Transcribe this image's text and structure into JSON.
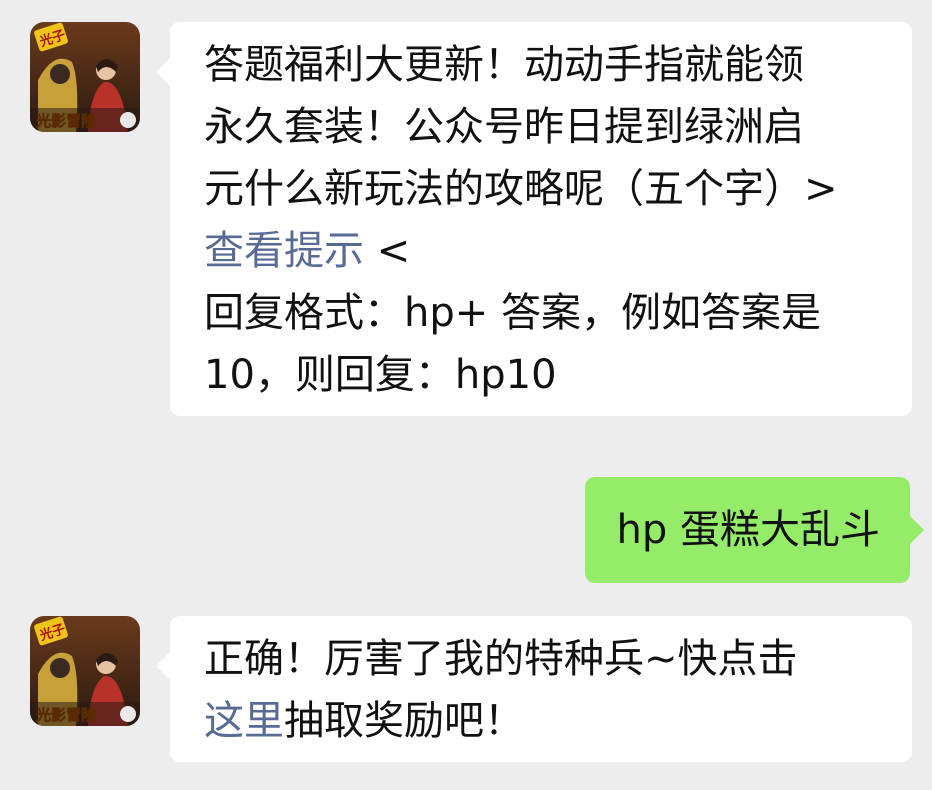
{
  "colors": {
    "background": "#ededed",
    "incoming_bubble": "#ffffff",
    "outgoing_bubble": "#95ec69",
    "link": "#576b95"
  },
  "avatar": {
    "icon": "game-app-icon",
    "badge_text": "光子",
    "banner_text": "光影冒险"
  },
  "messages": {
    "question": {
      "line1": "答题福利大更新！动动手指就能领",
      "line2": "永久套装！公众号昨日提到绿洲启",
      "line3": "元什么新玩法的攻略呢（五个字）>",
      "hint_link": "查看提示",
      "hint_suffix": " <",
      "line5": "回复格式：hp+ 答案，例如答案是",
      "line6": "10，则回复：hp10"
    },
    "reply": {
      "text": "hp 蛋糕大乱斗"
    },
    "result": {
      "line1": "正确！厉害了我的特种兵~快点击",
      "link": "这里",
      "line2_suffix": "抽取奖励吧！"
    }
  }
}
